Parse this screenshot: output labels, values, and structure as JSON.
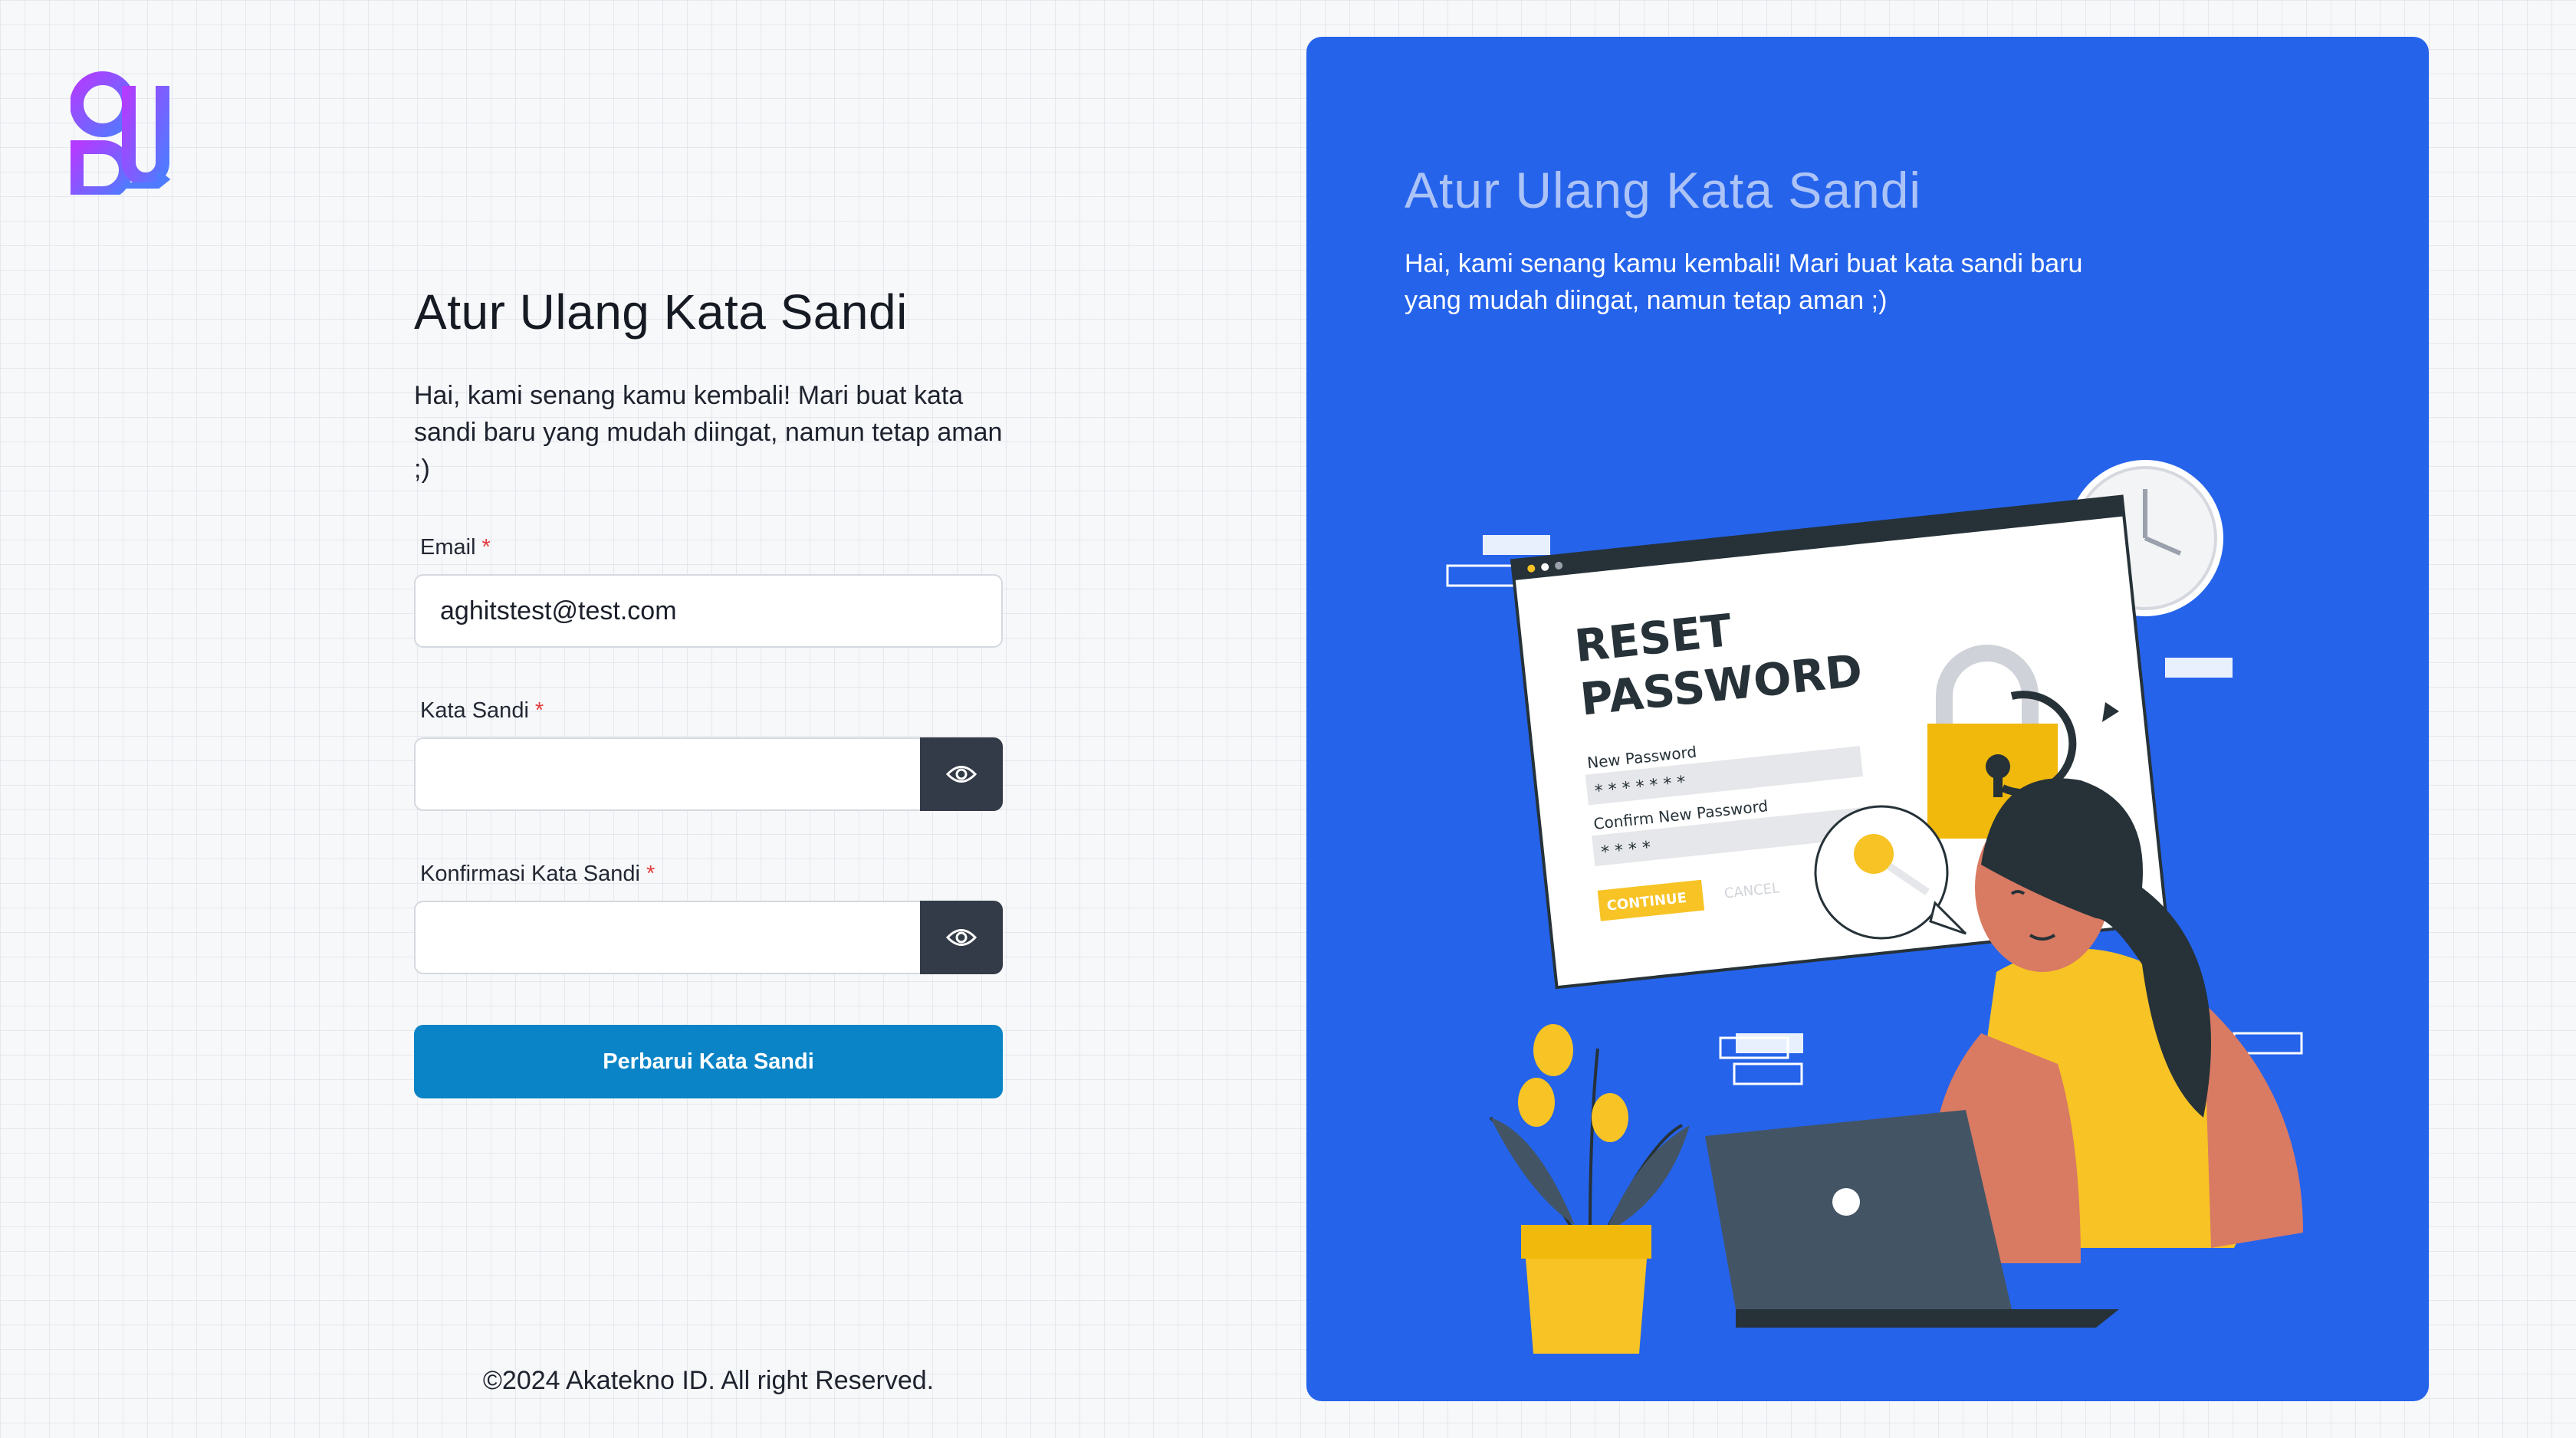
{
  "brand": {
    "logo_icon": "brand-logo-icon"
  },
  "form": {
    "title": "Atur Ulang Kata Sandi",
    "subtitle": "Hai, kami senang kamu kembali! Mari buat kata sandi baru yang mudah diingat, namun tetap aman ;)",
    "email_label": "Email",
    "email_value": "aghitstest@test.com",
    "password_label": "Kata Sandi",
    "confirm_label": "Konfirmasi Kata Sandi",
    "required_mark": "*",
    "submit_label": "Perbarui Kata Sandi",
    "eye_icon": "eye-icon"
  },
  "footer": {
    "copyright": "©2024 Akatekno ID. All right Reserved."
  },
  "panel": {
    "title": "Atur Ulang Kata Sandi",
    "subtitle": "Hai, kami senang kamu kembali! Mari buat kata sandi baru yang mudah diingat, namun tetap aman ;)",
    "illustration": {
      "heading_line1": "RESET",
      "heading_line2": "PASSWORD",
      "new_password_label": "New Password",
      "new_password_mask": "* * * * * * *",
      "confirm_label": "Confirm New Password",
      "confirm_mask": "* * * *",
      "continue_label": "CONTINUE",
      "cancel_label": "CANCEL"
    }
  },
  "colors": {
    "accent": "#2563eb",
    "button": "#0a84c6",
    "eye_button": "#343b48",
    "required": "#e23b3b"
  }
}
